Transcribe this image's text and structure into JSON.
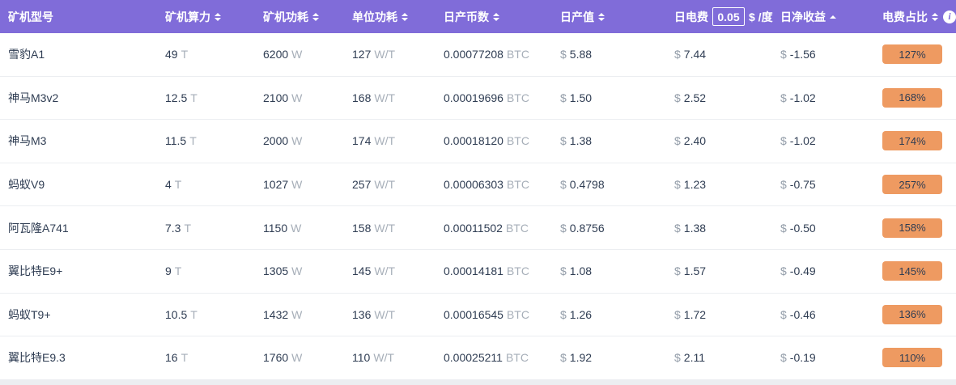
{
  "header": {
    "columns": [
      {
        "label": "矿机型号",
        "sort": "none"
      },
      {
        "label": "矿机算力",
        "sort": "both"
      },
      {
        "label": "矿机功耗",
        "sort": "both"
      },
      {
        "label": "单位功耗",
        "sort": "both"
      },
      {
        "label": "日产币数",
        "sort": "both"
      },
      {
        "label": "日产值",
        "sort": "both"
      },
      {
        "label": "日电费",
        "sort": "none",
        "input_value": "0.05",
        "suffix": "$ /度"
      },
      {
        "label": "日净收益",
        "sort": "asc"
      },
      {
        "label": "电费占比",
        "sort": "both",
        "has_info_icon": true
      }
    ]
  },
  "units": {
    "hashrate": "T",
    "power": "W",
    "unit_power": "W/T",
    "coins": "BTC",
    "currency": "$"
  },
  "icons": {
    "info": "i"
  },
  "colors": {
    "header_bg": "#806CD9",
    "badge_bg": "#EE9A61",
    "text_dark": "#2F3D53",
    "unit_gray": "#A6AEB8"
  },
  "rows": [
    {
      "model": "雪豹A1",
      "hashrate": "49",
      "power": "6200",
      "unit_power": "127",
      "coins": "0.00077208",
      "daily_value": "5.88",
      "electricity": "7.44",
      "net": "-1.56",
      "ratio": "127%"
    },
    {
      "model": "神马M3v2",
      "hashrate": "12.5",
      "power": "2100",
      "unit_power": "168",
      "coins": "0.00019696",
      "daily_value": "1.50",
      "electricity": "2.52",
      "net": "-1.02",
      "ratio": "168%"
    },
    {
      "model": "神马M3",
      "hashrate": "11.5",
      "power": "2000",
      "unit_power": "174",
      "coins": "0.00018120",
      "daily_value": "1.38",
      "electricity": "2.40",
      "net": "-1.02",
      "ratio": "174%"
    },
    {
      "model": "蚂蚁V9",
      "hashrate": "4",
      "power": "1027",
      "unit_power": "257",
      "coins": "0.00006303",
      "daily_value": "0.4798",
      "electricity": "1.23",
      "net": "-0.75",
      "ratio": "257%"
    },
    {
      "model": "阿瓦隆A741",
      "hashrate": "7.3",
      "power": "1150",
      "unit_power": "158",
      "coins": "0.00011502",
      "daily_value": "0.8756",
      "electricity": "1.38",
      "net": "-0.50",
      "ratio": "158%"
    },
    {
      "model": "翼比特E9+",
      "hashrate": "9",
      "power": "1305",
      "unit_power": "145",
      "coins": "0.00014181",
      "daily_value": "1.08",
      "electricity": "1.57",
      "net": "-0.49",
      "ratio": "145%"
    },
    {
      "model": "蚂蚁T9+",
      "hashrate": "10.5",
      "power": "1432",
      "unit_power": "136",
      "coins": "0.00016545",
      "daily_value": "1.26",
      "electricity": "1.72",
      "net": "-0.46",
      "ratio": "136%"
    },
    {
      "model": "翼比特E9.3",
      "hashrate": "16",
      "power": "1760",
      "unit_power": "110",
      "coins": "0.00025211",
      "daily_value": "1.92",
      "electricity": "2.11",
      "net": "-0.19",
      "ratio": "110%"
    }
  ]
}
